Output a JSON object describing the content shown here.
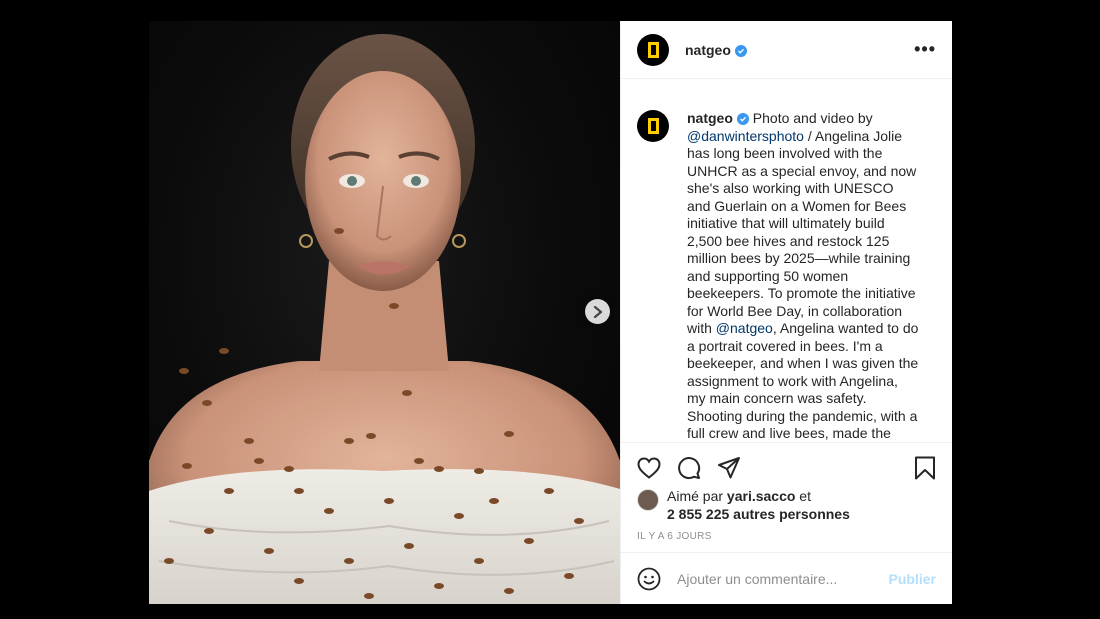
{
  "post": {
    "image_description": "",
    "carousel": {
      "slides": 2,
      "active": 1
    }
  },
  "header": {
    "username": "natgeo",
    "verified": true,
    "more_icon": "more-horizontal-icon",
    "more_glyph": "•••"
  },
  "caption": {
    "username": "natgeo",
    "text_part1": "Photo and video by ",
    "mention1": "@danwintersphoto",
    "text_part2": " / Angelina Jolie has long been involved with the UNHCR as a special envoy, and now she's also working with UNESCO and Guerlain on a Women for Bees initiative that will ultimately build 2,500 bee hives and restock 125 million bees by 2025—while training and supporting 50 women beekeepers. To promote the initiative for World Bee Day, in collaboration with ",
    "mention2": "@natgeo",
    "text_part3": ", Angelina wanted to do a portrait covered in bees. I'm a beekeeper, and when I was given the assignment to work with Angelina, my main concern was safety. Shooting during the pandemic, with a full crew and live bees, made the execution"
  },
  "actions": {
    "like_icon": "heart-icon",
    "comment_icon": "comment-icon",
    "share_icon": "share-icon",
    "save_icon": "bookmark-icon"
  },
  "likes": {
    "prefix": "Aimé par ",
    "user": "yari.sacco",
    "conj": " et",
    "count_text": "2 855 225 autres personnes"
  },
  "date": "IL Y A 6 JOURS",
  "comment_box": {
    "emoji_icon": "emoji-icon",
    "placeholder": "Ajouter un commentaire...",
    "publish_label": "Publier"
  },
  "colors": {
    "accent": "#3897f0",
    "natgeo_yellow": "#ffce00",
    "mention": "#00376b",
    "publish_disabled": "#b2dffc"
  }
}
